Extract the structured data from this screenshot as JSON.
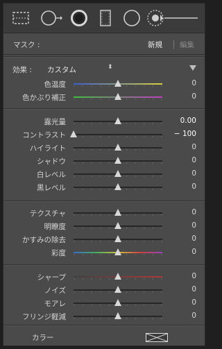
{
  "tools": [
    {
      "name": "graduated-filter-tool",
      "active": false
    },
    {
      "name": "spot-removal-tool",
      "active": false
    },
    {
      "name": "adjustment-brush-tool",
      "active": true
    },
    {
      "name": "crop-tool",
      "active": false
    },
    {
      "name": "radial-filter-tool",
      "active": false
    },
    {
      "name": "range-mask-tool",
      "active": false
    }
  ],
  "mask": {
    "label": "マスク :",
    "new_label": "新規",
    "edit_label": "編集"
  },
  "effect": {
    "label": "効果 :",
    "value": "カスタム",
    "updown": "⬍"
  },
  "sliders": [
    {
      "key": "temp",
      "label": "色温度",
      "value": "0",
      "position": 0.5,
      "track": "temp"
    },
    {
      "key": "tint",
      "label": "色かぶり補正",
      "value": "0",
      "position": 0.5,
      "track": "tint"
    },
    {
      "key": "exposure",
      "label": "露光量",
      "value": "0.00",
      "position": 0.5,
      "track": "plain",
      "bright": true
    },
    {
      "key": "contrast",
      "label": "コントラスト",
      "value": "− 100",
      "position": 0.0,
      "track": "plain",
      "bright": true
    },
    {
      "key": "highlights",
      "label": "ハイライト",
      "value": "0",
      "position": 0.5,
      "track": "plain"
    },
    {
      "key": "shadows",
      "label": "シャドウ",
      "value": "0",
      "position": 0.5,
      "track": "plain"
    },
    {
      "key": "whites",
      "label": "白レベル",
      "value": "0",
      "position": 0.5,
      "track": "plain"
    },
    {
      "key": "blacks",
      "label": "黒レベル",
      "value": "0",
      "position": 0.5,
      "track": "plain"
    },
    {
      "key": "texture",
      "label": "テクスチャ",
      "value": "0",
      "position": 0.5,
      "track": "plain"
    },
    {
      "key": "clarity",
      "label": "明瞭度",
      "value": "0",
      "position": 0.5,
      "track": "plain"
    },
    {
      "key": "dehaze",
      "label": "かすみの除去",
      "value": "0",
      "position": 0.5,
      "track": "plain"
    },
    {
      "key": "saturation",
      "label": "彩度",
      "value": "0",
      "position": 0.5,
      "track": "sat"
    },
    {
      "key": "sharpness",
      "label": "シャープ",
      "value": "0",
      "position": 0.5,
      "track": "sharp"
    },
    {
      "key": "noise",
      "label": "ノイズ",
      "value": "0",
      "position": 0.5,
      "track": "plain"
    },
    {
      "key": "moire",
      "label": "モアレ",
      "value": "0",
      "position": 0.5,
      "track": "plain"
    },
    {
      "key": "defringe",
      "label": "フリンジ軽減",
      "value": "0",
      "position": 0.5,
      "track": "plain"
    }
  ],
  "color": {
    "label": "カラー"
  },
  "colors": {
    "panel": "#4a4a4a",
    "temp_gradient": [
      "#3a5fd0",
      "#d8d040"
    ],
    "tint_gradient": [
      "#40c040",
      "#c040c0"
    ],
    "sat_gradient": [
      "#5a5a5a",
      "#d04040"
    ],
    "sharp_gradient": [
      "#404040",
      "#b03838"
    ]
  }
}
